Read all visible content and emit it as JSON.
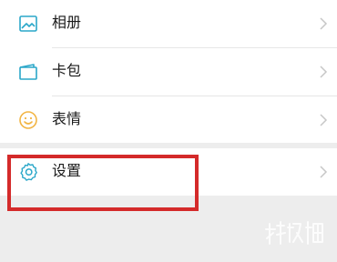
{
  "menu": {
    "items": [
      {
        "label": "相册",
        "icon": "photo-album-icon"
      },
      {
        "label": "卡包",
        "icon": "card-wallet-icon"
      },
      {
        "label": "表情",
        "icon": "smiley-icon"
      }
    ],
    "settings": {
      "label": "设置",
      "icon": "gear-icon"
    }
  },
  "annotation": {
    "color": "#d42a2a"
  },
  "colors": {
    "icon_teal": "#2aa7c9",
    "icon_smiley": "#f2b544",
    "background": "#ededed"
  }
}
